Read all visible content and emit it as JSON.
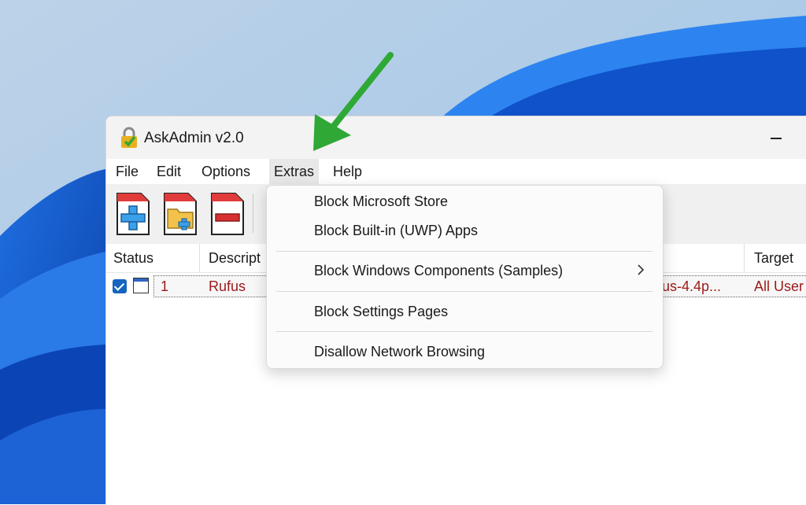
{
  "window": {
    "title": "AskAdmin v2.0"
  },
  "menubar": {
    "items": [
      "File",
      "Edit",
      "Options",
      "Extras",
      "Help"
    ],
    "active": "Extras"
  },
  "toolbar": {
    "buttons": [
      "add-file-icon",
      "add-folder-icon",
      "remove-icon"
    ]
  },
  "columns": [
    "Status",
    "Descript",
    "Target"
  ],
  "rows": [
    {
      "id": "1",
      "description": "Rufus",
      "path": "fus-4.4p...",
      "target": "All User",
      "checked": true
    }
  ],
  "extras_menu": {
    "items": [
      "Block Microsoft Store",
      "Block Built-in (UWP) Apps",
      "Block Windows Components (Samples)",
      "Block Settings Pages",
      "Disallow Network Browsing"
    ],
    "submenu_arrow": ">"
  },
  "colors": {
    "accent": "#1565c0",
    "row_text": "#9c1a1a",
    "pointer_arrow": "#2fa836"
  }
}
